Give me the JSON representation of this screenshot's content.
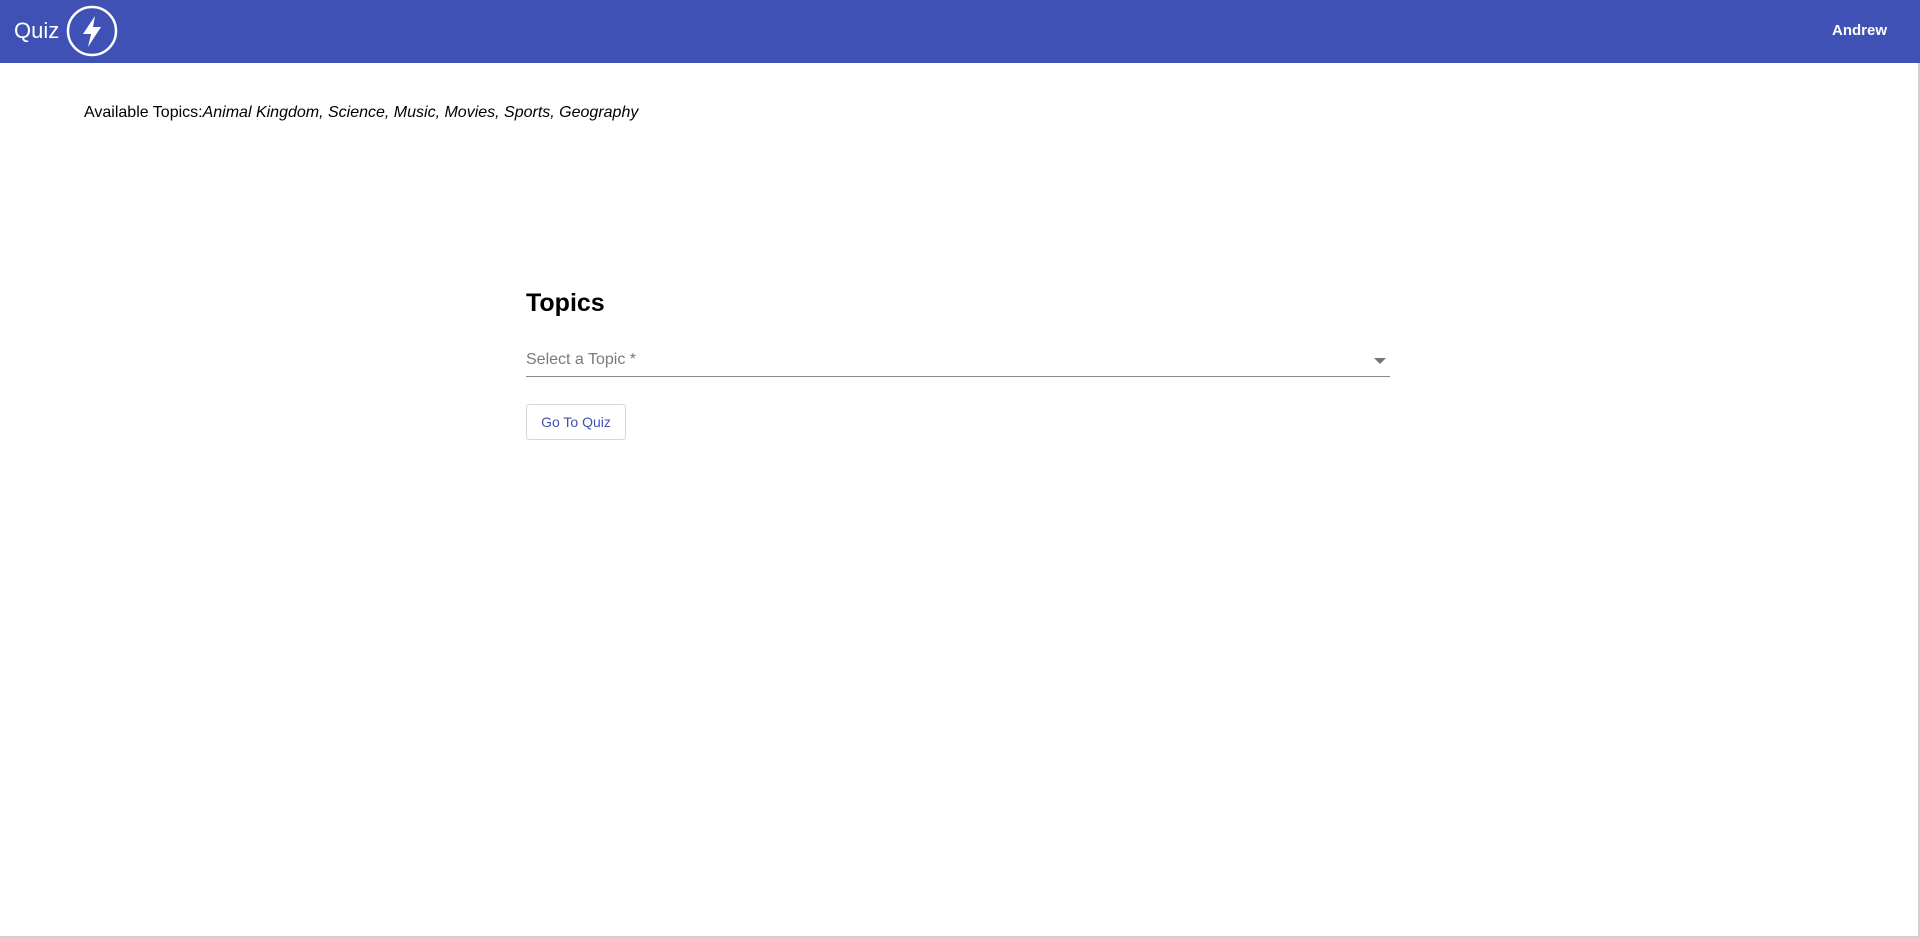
{
  "header": {
    "app_title": "Quiz",
    "logo_icon": "lightning-bolt-icon",
    "user_name": "Andrew",
    "background_color": "#3f51b5"
  },
  "info": {
    "available_label": "Available Topics:",
    "topics_list": "Animal Kingdom, Science, Music, Movies, Sports, Geography"
  },
  "topics_form": {
    "title": "Topics",
    "select_placeholder": "Select a Topic *",
    "submit_label": "Go To Quiz"
  }
}
